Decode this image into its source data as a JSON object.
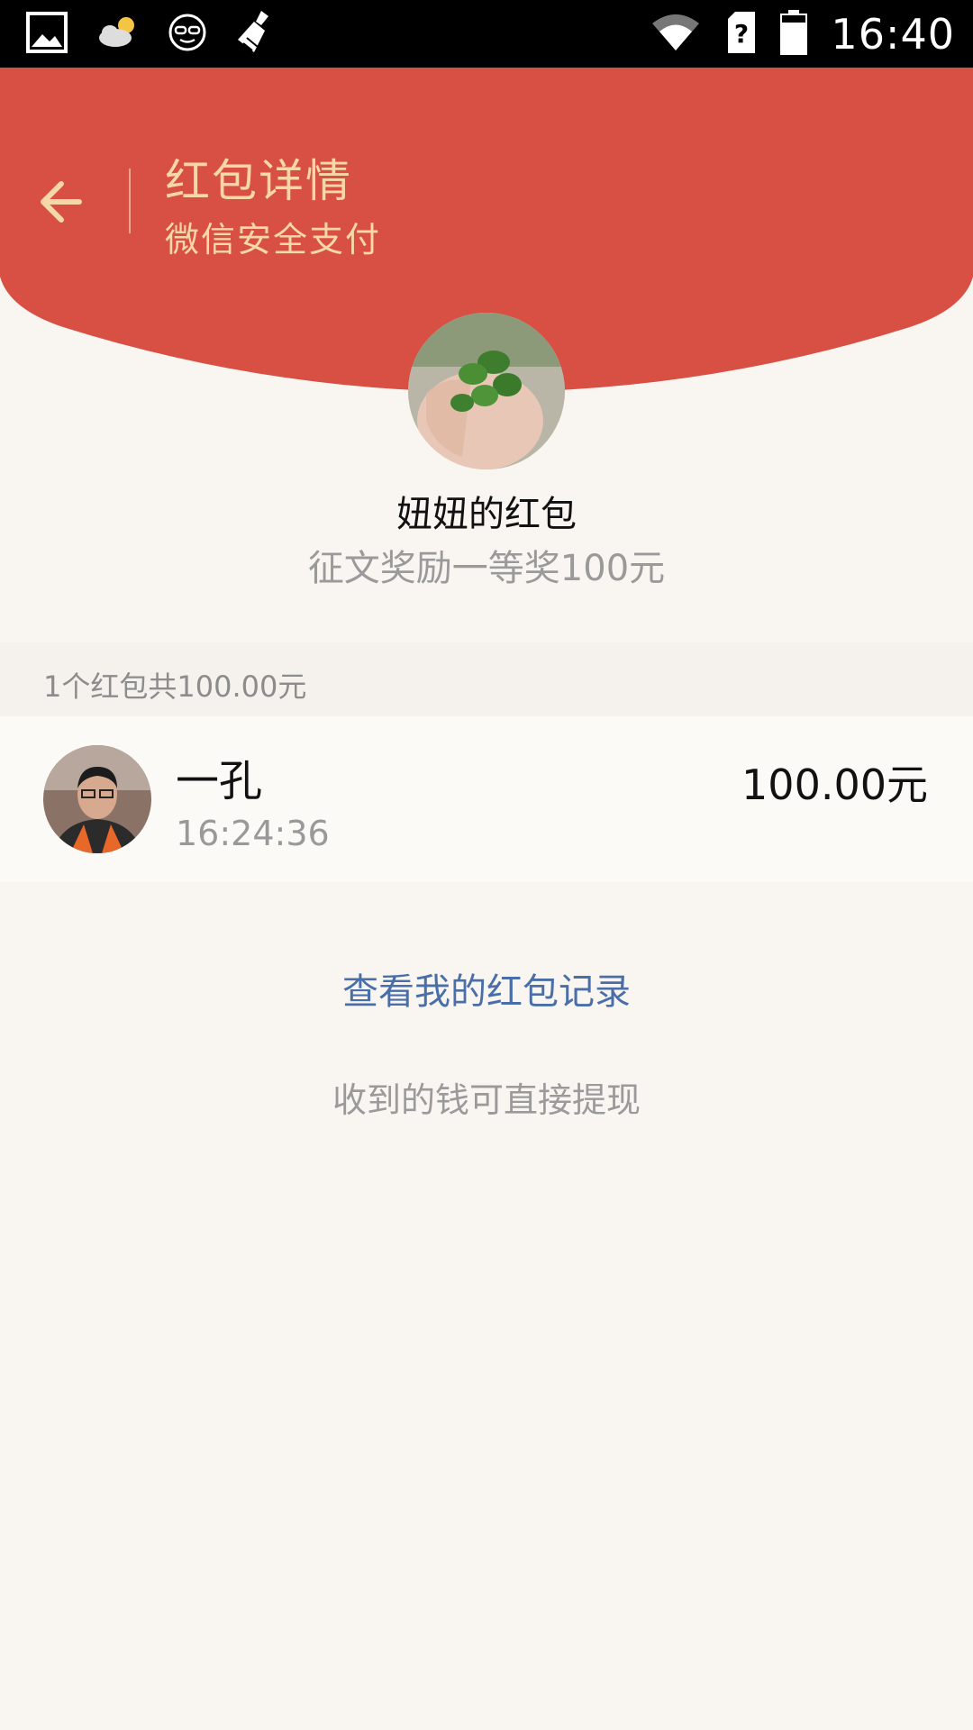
{
  "status_bar": {
    "time": "16:40",
    "left_icons": [
      "image-icon",
      "weather-icon",
      "glasses-icon",
      "broom-icon"
    ],
    "right_icons": [
      "wifi-icon",
      "sim-unknown-icon",
      "battery-icon"
    ]
  },
  "header": {
    "title": "红包详情",
    "subtitle": "微信安全支付",
    "color": "#d84f43"
  },
  "sender": {
    "name": "妞妞的红包",
    "greeting": "征文奖励一等奖100元"
  },
  "summary": {
    "text": "1个红包共100.00元"
  },
  "records": [
    {
      "name": "一孔",
      "time": "16:24:36",
      "amount": "100.00元"
    }
  ],
  "footer": {
    "link": "查看我的红包记录",
    "note": "收到的钱可直接提现",
    "link_color": "#4a6fa8"
  }
}
